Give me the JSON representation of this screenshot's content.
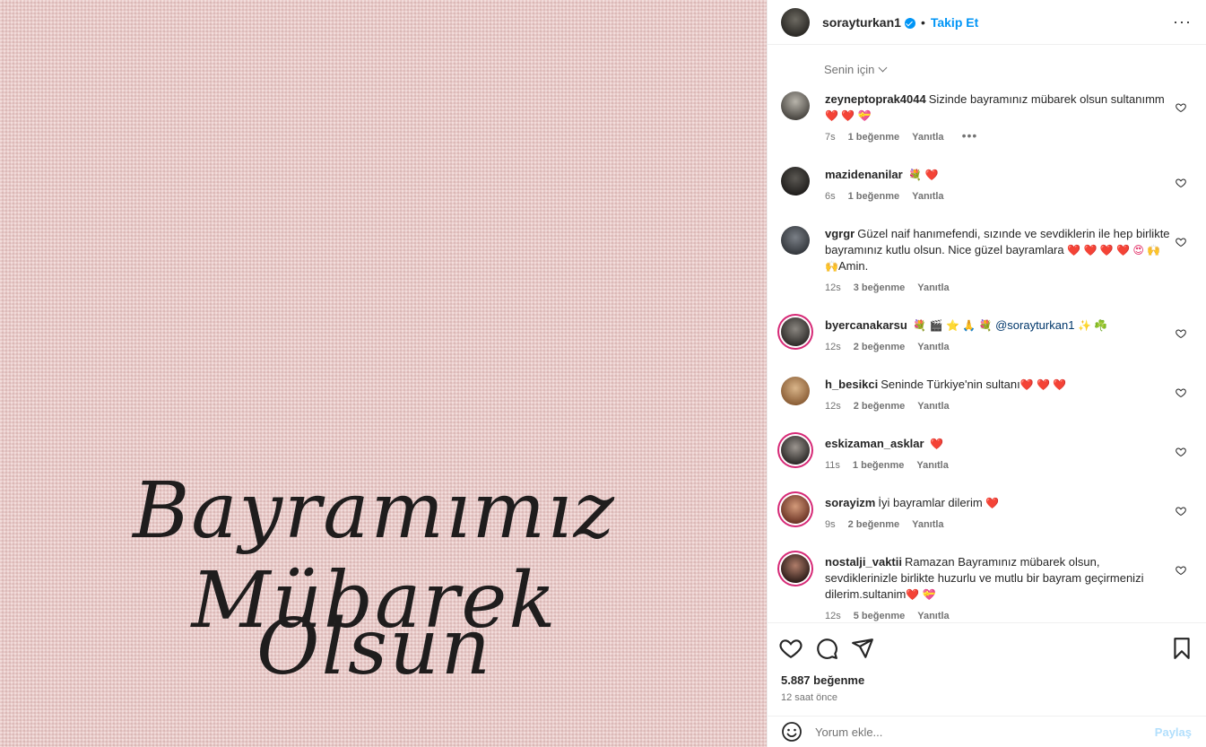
{
  "image": {
    "line1": "Bayramımız Mübarek",
    "line2": "Olsun"
  },
  "header": {
    "username": "sorayturkan1",
    "separator": "•",
    "follow_label": "Takip Et",
    "more_label": "···"
  },
  "filter": {
    "label": "Senin için"
  },
  "comments": [
    {
      "user": "zeyneptoprak4044",
      "text": "Sizinde bayramınız mübarek olsun sultanımm",
      "emojis": "❤️ ❤️ 💝",
      "time": "7s",
      "likes": "1 beğenme",
      "reply": "Yanıtla",
      "more": "•••"
    },
    {
      "user": "mazidenanilar",
      "text": "",
      "emojis": "💐 ❤️",
      "time": "6s",
      "likes": "1 beğenme",
      "reply": "Yanıtla"
    },
    {
      "user": "vgrgr",
      "text": "Güzel naif hanımefendi, sızınde ve sevdiklerin ile hep birlikte bayramınız kutlu olsun. Nice güzel bayramlara",
      "emojis": "❤️ ❤️ ❤️ ❤️ 😍 🙌 🙌",
      "tail": "Amin.",
      "time": "12s",
      "likes": "3 beğenme",
      "reply": "Yanıtla"
    },
    {
      "user": "byercanakarsu",
      "text": "",
      "emojis": "💐 🎬 ⭐ 🙏 💐",
      "mention": "@sorayturkan1",
      "emojis2": "✨ ☘️",
      "time": "12s",
      "likes": "2 beğenme",
      "reply": "Yanıtla"
    },
    {
      "user": "h_besikci",
      "text": "Seninde Türkiye'nin sultanı",
      "emojis": "❤️ ❤️ ❤️",
      "time": "12s",
      "likes": "2 beğenme",
      "reply": "Yanıtla"
    },
    {
      "user": "eskizaman_asklar",
      "text": "",
      "emojis": "❤️",
      "time": "11s",
      "likes": "1 beğenme",
      "reply": "Yanıtla"
    },
    {
      "user": "sorayizm",
      "text": "İyi bayramlar dilerim",
      "emojis": "❤️",
      "time": "9s",
      "likes": "2 beğenme",
      "reply": "Yanıtla"
    },
    {
      "user": "nostalji_vaktii",
      "text": "Ramazan Bayramınız mübarek olsun, sevdiklerinizle birlikte huzurlu ve mutlu bir bayram geçirmenizi dilerim.sultanim",
      "emojis": "❤️ 💝",
      "time": "12s",
      "likes": "5 beğenme",
      "reply": "Yanıtla"
    }
  ],
  "stats": {
    "likes": "5.887 beğenme",
    "time": "12 saat önce"
  },
  "add_comment": {
    "placeholder": "Yorum ekle...",
    "post_label": "Paylaş"
  },
  "colors": {
    "accent": "#0095f6",
    "heart": "#e0245e",
    "image_bg": "#e8c8c6",
    "ring": "#d62976"
  }
}
